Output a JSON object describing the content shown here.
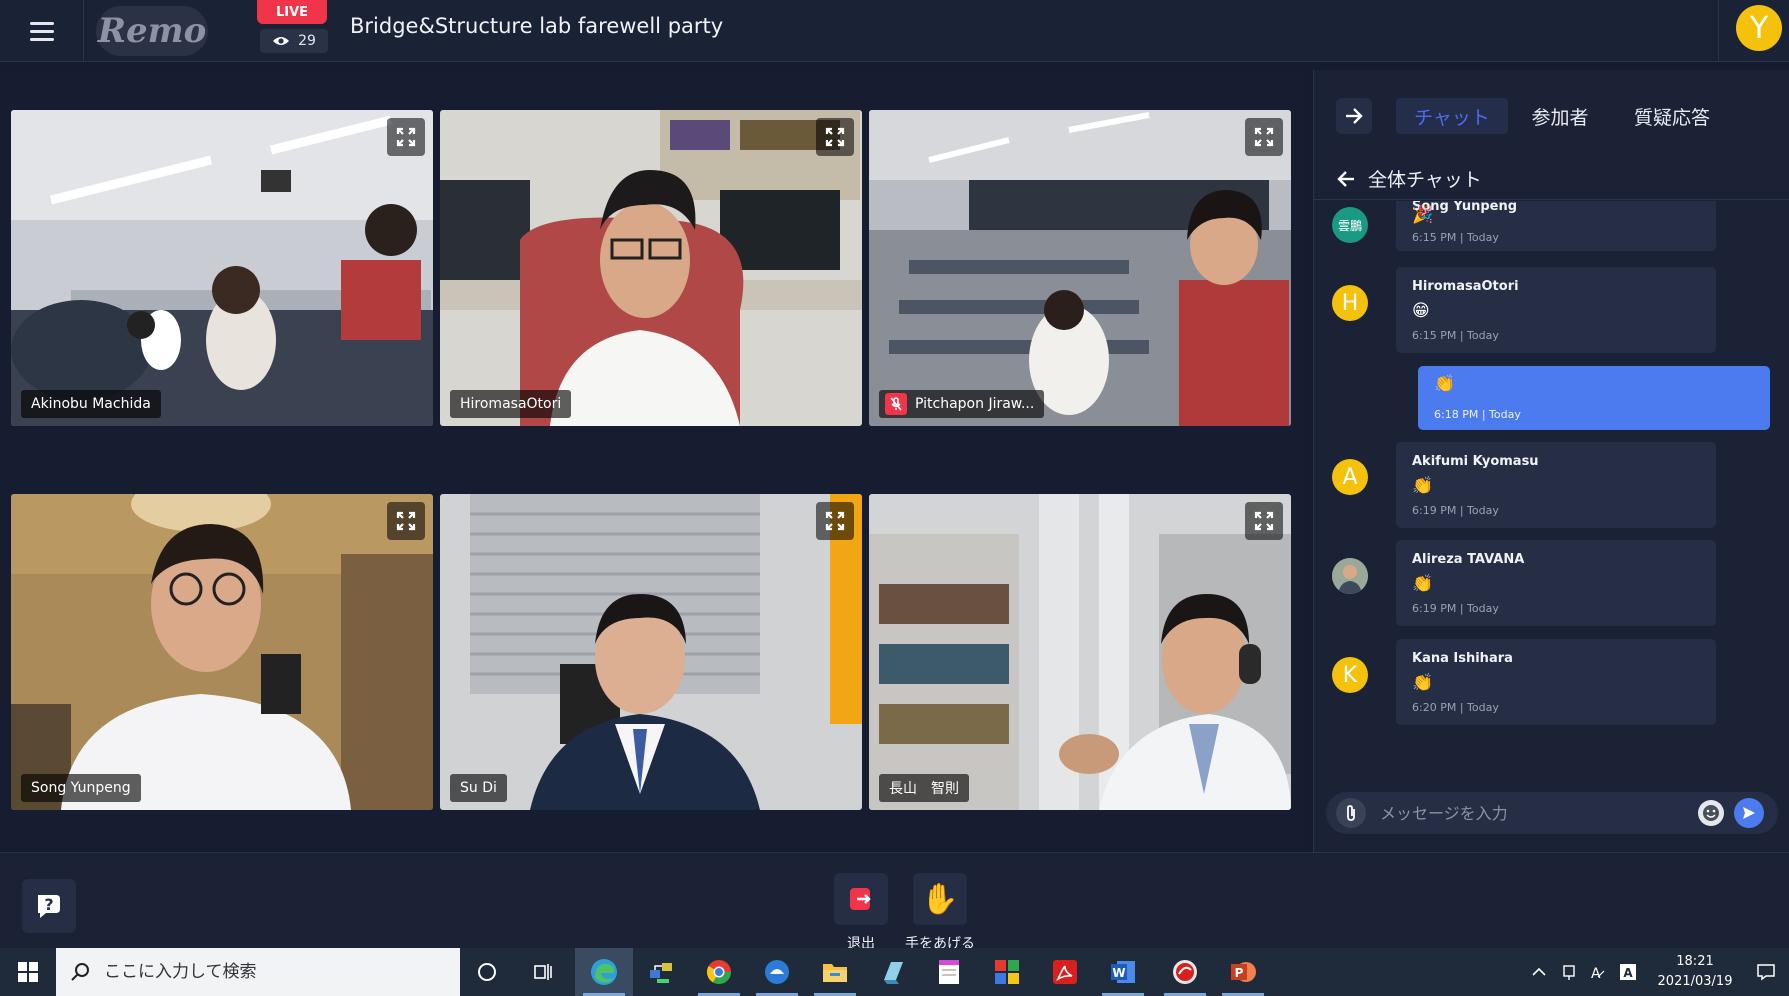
{
  "header": {
    "logo": "Remo",
    "live_badge": "LIVE",
    "viewer_count": "29",
    "event_title": "Bridge&Structure lab farewell party",
    "user_initial": "Y"
  },
  "videos": [
    {
      "name": "Akinobu Machida",
      "muted": false
    },
    {
      "name": "HiromasaOtori",
      "muted": false
    },
    {
      "name": "Pitchapon Jiraw...",
      "muted": true
    },
    {
      "name": "Song Yunpeng",
      "muted": false
    },
    {
      "name": "Su Di",
      "muted": false
    },
    {
      "name": "長山　智則",
      "muted": false
    }
  ],
  "panel": {
    "tabs": [
      "チャット",
      "参加者",
      "質疑応答"
    ],
    "active_tab": "チャット",
    "chat_title": "全体チャット",
    "messages": [
      {
        "sender": "Song Yunpeng",
        "avatar_text": "雲鵬",
        "avatar_color": "#1a9a82",
        "emoji": "🎉",
        "time": "6:15 PM | Today"
      },
      {
        "sender": "HiromasaOtori",
        "avatar_text": "H",
        "avatar_color": "#f4c20d",
        "emoji": "😁",
        "time": "6:15 PM | Today"
      },
      {
        "sender": "",
        "avatar_text": "",
        "avatar_color": "",
        "emoji": "👏",
        "time": "6:18 PM | Today",
        "mine": true
      },
      {
        "sender": "Akifumi Kyomasu",
        "avatar_text": "A",
        "avatar_color": "#f4c20d",
        "emoji": "👏",
        "time": "6:19 PM | Today"
      },
      {
        "sender": "Alireza TAVANA",
        "avatar_text": "",
        "avatar_color": "#7a8a7a",
        "emoji": "👏",
        "time": "6:19 PM | Today"
      },
      {
        "sender": "Kana Ishihara",
        "avatar_text": "K",
        "avatar_color": "#f4c20d",
        "emoji": "👏",
        "time": "6:20 PM | Today"
      }
    ],
    "input_placeholder": "メッセージを入力"
  },
  "controls": {
    "leave_label": "退出",
    "raise_hand_label": "手をあげる"
  },
  "taskbar": {
    "search_placeholder": "ここに入力して検索",
    "time": "18:21",
    "date": "2021/03/19"
  },
  "colors": {
    "accent": "#4c7bf0",
    "live": "#f0354a",
    "avatar_yellow": "#f4c20d"
  }
}
